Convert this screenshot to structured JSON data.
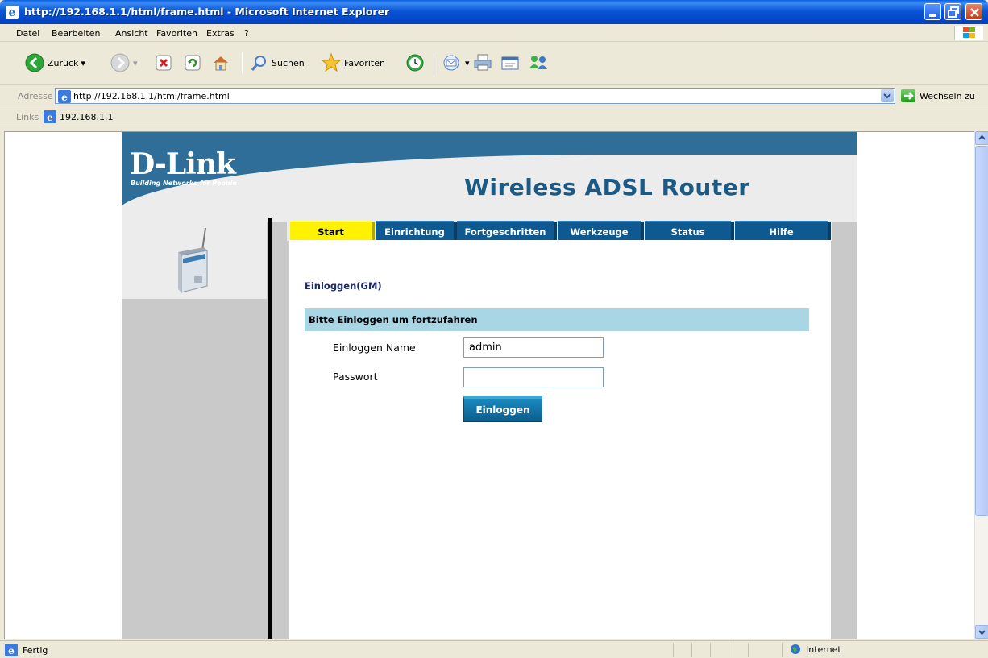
{
  "window": {
    "title": "http://192.168.1.1/html/frame.html - Microsoft Internet Explorer"
  },
  "menu": {
    "items": [
      "Datei",
      "Bearbeiten",
      "Ansicht",
      "Favoriten",
      "Extras",
      "?"
    ]
  },
  "toolbar": {
    "back_label": "Zurück",
    "search_label": "Suchen",
    "favorites_label": "Favoriten"
  },
  "address": {
    "label": "Adresse",
    "url": "http://192.168.1.1/html/frame.html",
    "go_label": "Wechseln zu"
  },
  "links": {
    "label": "Links",
    "item": "192.168.1.1"
  },
  "router": {
    "brand": "D-Link",
    "tagline": "Building Networks for People",
    "product": "Wireless ADSL Router",
    "tabs": [
      "Start",
      "Einrichtung",
      "Fortgeschritten",
      "Werkzeuge",
      "Status",
      "Hilfe"
    ],
    "active_tab": "Start",
    "section_title": "Einloggen(GM)",
    "login_header": "Bitte Einloggen um fortzufahren",
    "username_label": "Einloggen Name",
    "username_value": "admin",
    "password_label": "Passwort",
    "password_value": "",
    "login_button": "Einloggen"
  },
  "status": {
    "text": "Fertig",
    "zone": "Internet"
  },
  "colors": {
    "tab_blue": "#0E5A90",
    "tab_active": "#FFF200",
    "login_header_bg": "#A9D6E4",
    "banner_blue": "#2E6E98"
  }
}
